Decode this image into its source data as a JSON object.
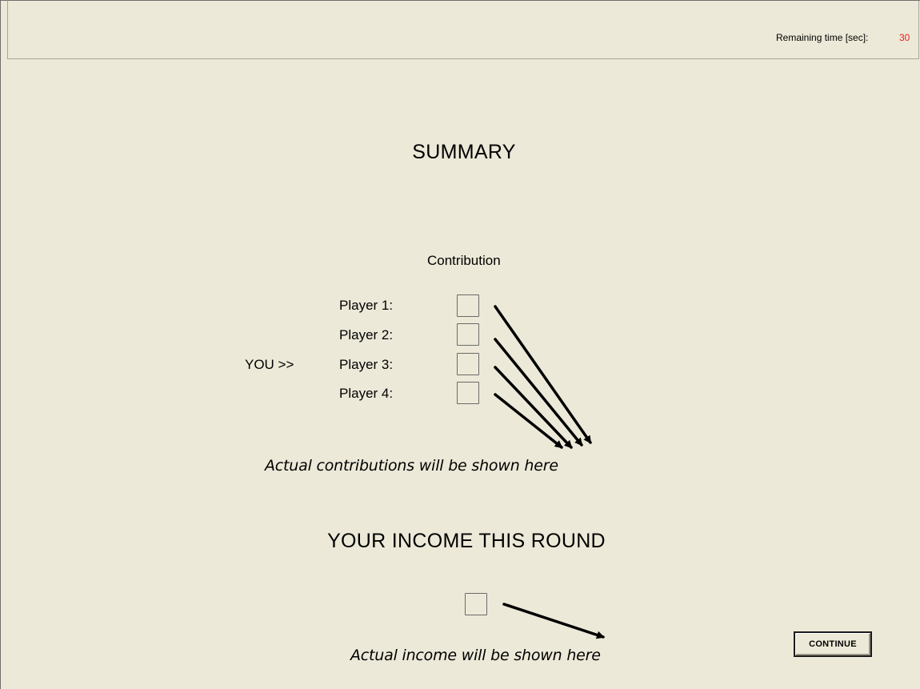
{
  "header": {
    "timer_label": "Remaining time [sec]:",
    "timer_value": "30",
    "timer_color": "#e8201c"
  },
  "summary": {
    "title": "SUMMARY",
    "column_header": "Contribution",
    "you_marker": "YOU >>",
    "players": [
      {
        "label": "Player 1:",
        "contribution": ""
      },
      {
        "label": "Player 2:",
        "contribution": ""
      },
      {
        "label": "Player 3:",
        "contribution": ""
      },
      {
        "label": "Player 4:",
        "contribution": ""
      }
    ],
    "note": "Actual contributions will be shown here"
  },
  "income": {
    "title": "YOUR INCOME THIS ROUND",
    "value": "",
    "note": "Actual income will be shown here"
  },
  "actions": {
    "continue_label": "CONTINUE"
  },
  "colors": {
    "background": "#ece9d8",
    "timer": "#e8201c"
  }
}
